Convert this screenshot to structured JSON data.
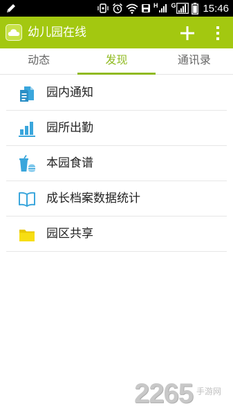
{
  "status_bar": {
    "time": "15:46",
    "network_letters": [
      "H",
      "G"
    ],
    "icons": [
      "edit-pencil-icon",
      "vibrate-icon",
      "alarm-icon",
      "wifi-icon",
      "save-icon",
      "signal-icon",
      "signal-icon",
      "battery-icon"
    ]
  },
  "app_bar": {
    "title": "幼儿园在线",
    "logo": "cloud-logo-icon",
    "actions": [
      "plus-icon",
      "more-vert-icon"
    ]
  },
  "tabs": [
    {
      "label": "动态",
      "active": false
    },
    {
      "label": "发现",
      "active": true
    },
    {
      "label": "通讯录",
      "active": false
    }
  ],
  "menu": [
    {
      "label": "园内通知",
      "icon": "document-icon"
    },
    {
      "label": "园所出勤",
      "icon": "bar-chart-icon"
    },
    {
      "label": "本园食谱",
      "icon": "food-drink-icon"
    },
    {
      "label": "成长档案数据统计",
      "icon": "open-book-icon"
    },
    {
      "label": "园区共享",
      "icon": "folder-icon"
    }
  ],
  "watermark": {
    "number": "2265",
    "sub": "手游网"
  },
  "colors": {
    "app_bar": "#a3c810",
    "accent": "#8fba1f",
    "icon_blue": "#3aa6dc",
    "folder_yellow": "#f5d90a"
  }
}
